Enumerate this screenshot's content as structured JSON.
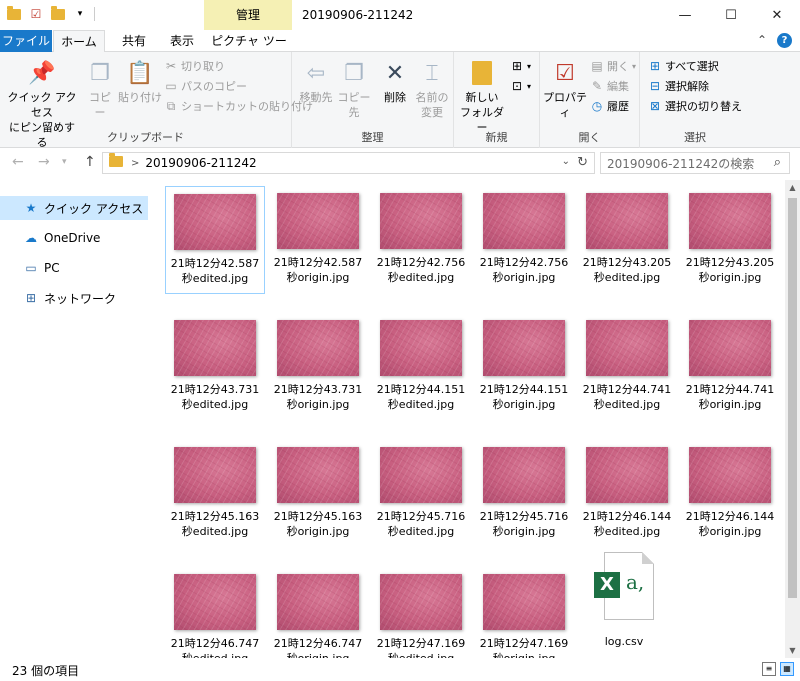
{
  "titlebar": {
    "context_group": "管理",
    "window_title": "20190906-211242"
  },
  "tabs": {
    "file": "ファイル",
    "home": "ホーム",
    "share": "共有",
    "view": "表示",
    "picture_tools": "ピクチャ ツール"
  },
  "ribbon": {
    "clipboard": {
      "label": "クリップボード",
      "pin_line1": "クイック アクセス",
      "pin_line2": "にピン留めする",
      "copy": "コピー",
      "paste": "貼り付け",
      "cut": "切り取り",
      "copy_path": "パスのコピー",
      "paste_shortcut": "ショートカットの貼り付け"
    },
    "organize": {
      "label": "整理",
      "move_to": "移動先",
      "copy_to": "コピー先",
      "delete": "削除",
      "rename_line1": "名前の",
      "rename_line2": "変更"
    },
    "new": {
      "label": "新規",
      "new_folder_line1": "新しい",
      "new_folder_line2": "フォルダー"
    },
    "open": {
      "label": "開く",
      "properties": "プロパティ",
      "open": "開く",
      "edit": "編集",
      "history": "履歴"
    },
    "select": {
      "label": "選択",
      "select_all": "すべて選択",
      "select_none": "選択解除",
      "invert": "選択の切り替え"
    }
  },
  "address": {
    "path": "20190906-211242",
    "search_placeholder": "20190906-211242の検索"
  },
  "nav": {
    "items": [
      {
        "label": "クイック アクセス",
        "icon": "star-icon"
      },
      {
        "label": "OneDrive",
        "icon": "cloud-icon"
      },
      {
        "label": "PC",
        "icon": "computer-icon"
      },
      {
        "label": "ネットワーク",
        "icon": "network-icon"
      }
    ]
  },
  "files": [
    {
      "line1": "21時12分42.587",
      "line2": "秒edited.jpg"
    },
    {
      "line1": "21時12分42.587",
      "line2": "秒origin.jpg"
    },
    {
      "line1": "21時12分42.756",
      "line2": "秒edited.jpg"
    },
    {
      "line1": "21時12分42.756",
      "line2": "秒origin.jpg"
    },
    {
      "line1": "21時12分43.205",
      "line2": "秒edited.jpg"
    },
    {
      "line1": "21時12分43.205",
      "line2": "秒origin.jpg"
    },
    {
      "line1": "21時12分43.731",
      "line2": "秒edited.jpg"
    },
    {
      "line1": "21時12分43.731",
      "line2": "秒origin.jpg"
    },
    {
      "line1": "21時12分44.151",
      "line2": "秒edited.jpg"
    },
    {
      "line1": "21時12分44.151",
      "line2": "秒origin.jpg"
    },
    {
      "line1": "21時12分44.741",
      "line2": "秒edited.jpg"
    },
    {
      "line1": "21時12分44.741",
      "line2": "秒origin.jpg"
    },
    {
      "line1": "21時12分45.163",
      "line2": "秒edited.jpg"
    },
    {
      "line1": "21時12分45.163",
      "line2": "秒origin.jpg"
    },
    {
      "line1": "21時12分45.716",
      "line2": "秒edited.jpg"
    },
    {
      "line1": "21時12分45.716",
      "line2": "秒origin.jpg"
    },
    {
      "line1": "21時12分46.144",
      "line2": "秒edited.jpg"
    },
    {
      "line1": "21時12分46.144",
      "line2": "秒origin.jpg"
    },
    {
      "line1": "21時12分46.747",
      "line2": "秒edited.jpg"
    },
    {
      "line1": "21時12分46.747",
      "line2": "秒origin.jpg"
    },
    {
      "line1": "21時12分47.169",
      "line2": "秒edited.jpg"
    },
    {
      "line1": "21時12分47.169",
      "line2": "秒origin.jpg"
    }
  ],
  "csv_file": {
    "name": "log.csv",
    "icon_letter": "X",
    "icon_glyph": "a,"
  },
  "status": {
    "count": "23 個の項目"
  },
  "colors": {
    "accent": "#1979ca",
    "selected": "#cce8ff",
    "context_tab": "#f5f0b4",
    "excel_green": "#1d7044"
  }
}
